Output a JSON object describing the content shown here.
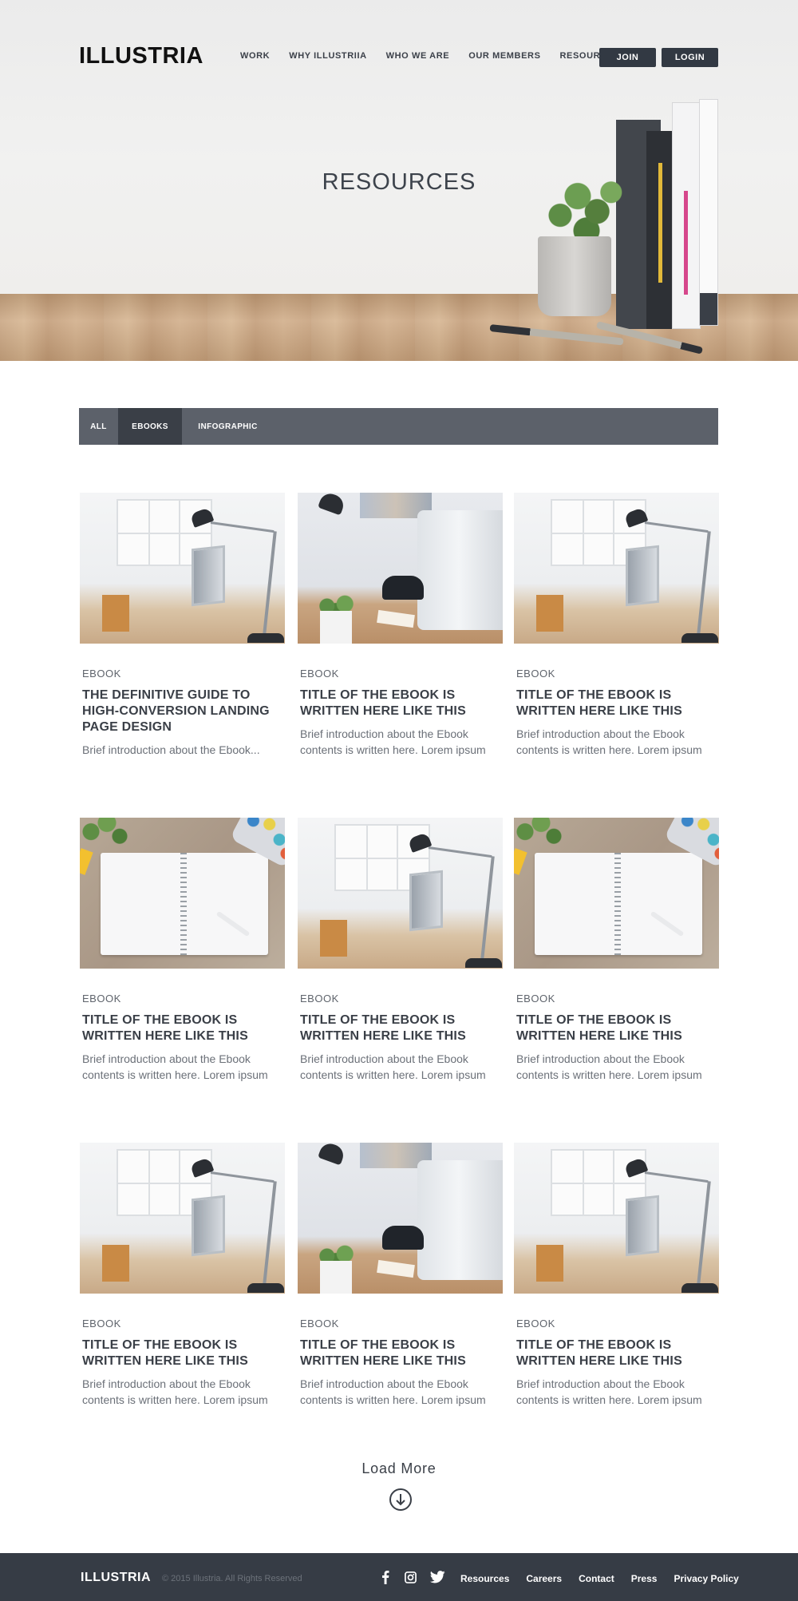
{
  "brand": {
    "logo": "ILLUSTRIA"
  },
  "header": {
    "nav": [
      "WORK",
      "WHY ILLUSTRIIA",
      "WHO WE ARE",
      "OUR MEMBERS",
      "RESOURCES"
    ],
    "join_label": "JOIN",
    "login_label": "LOGIN"
  },
  "hero": {
    "title": "RESOURCES"
  },
  "filters": {
    "tabs": [
      {
        "label": "ALL",
        "active": false
      },
      {
        "label": "EBOOKS",
        "active": true
      },
      {
        "label": "INFOGRAPHIC",
        "active": false
      }
    ]
  },
  "cards": [
    {
      "category": "EBOOK",
      "title": "THE DEFINITIVE GUIDE TO HIGH-CONVERSION LANDING PAGE DESIGN",
      "desc": "Brief introduction about the Ebook...",
      "image": "desk-lamp-photo"
    },
    {
      "category": "EBOOK",
      "title": "TITLE OF THE EBOOK IS WRITTEN HERE LIKE THIS",
      "desc": "Brief introduction about the Ebook contents is written here. Lorem ipsum",
      "image": "imac-desk-photo"
    },
    {
      "category": "EBOOK",
      "title": "TITLE OF THE EBOOK IS WRITTEN HERE LIKE THIS",
      "desc": "Brief introduction about the Ebook contents is written here. Lorem ipsum",
      "image": "desk-lamp-photo"
    },
    {
      "category": "EBOOK",
      "title": "TITLE OF THE EBOOK IS WRITTEN HERE LIKE THIS",
      "desc": "Brief introduction about the Ebook contents is written here. Lorem ipsum",
      "image": "notebook-photo"
    },
    {
      "category": "EBOOK",
      "title": "TITLE OF THE EBOOK IS WRITTEN HERE LIKE THIS",
      "desc": "Brief introduction about the Ebook contents is written here. Lorem ipsum",
      "image": "desk-lamp-photo"
    },
    {
      "category": "EBOOK",
      "title": "TITLE OF THE EBOOK IS WRITTEN HERE LIKE THIS",
      "desc": "Brief introduction about the Ebook contents is written here. Lorem ipsum",
      "image": "notebook-photo"
    },
    {
      "category": "EBOOK",
      "title": "TITLE OF THE EBOOK IS WRITTEN HERE LIKE THIS",
      "desc": "Brief introduction about the Ebook contents is written here. Lorem ipsum",
      "image": "desk-lamp-photo"
    },
    {
      "category": "EBOOK",
      "title": "TITLE OF THE EBOOK IS WRITTEN HERE LIKE THIS",
      "desc": "Brief introduction about the Ebook contents is written here. Lorem ipsum",
      "image": "imac-desk-photo"
    },
    {
      "category": "EBOOK",
      "title": "TITLE OF THE EBOOK IS WRITTEN HERE LIKE THIS",
      "desc": "Brief introduction about the Ebook contents is written here. Lorem ipsum",
      "image": "desk-lamp-photo"
    }
  ],
  "load_more": {
    "label": "Load More",
    "icon": "arrow-down-circle-icon"
  },
  "footer": {
    "logo": "ILLUSTRIA",
    "copyright": "© 2015 Illustria. All Rights Reserved",
    "social": [
      "facebook-icon",
      "instagram-icon",
      "twitter-icon"
    ],
    "links": [
      "Resources",
      "Careers",
      "Contact",
      "Press",
      "Privacy Policy"
    ]
  },
  "colors": {
    "dark": "#323943",
    "filter_bar": "#5c616a",
    "filter_active": "#3a3f47",
    "footer": "#363c45",
    "text": "#3a3f47"
  }
}
